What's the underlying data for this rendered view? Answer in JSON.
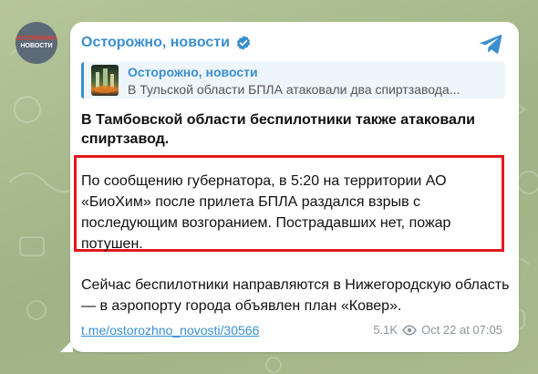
{
  "colors": {
    "accent": "#3a8fcf",
    "highlight_border": "#e0191e",
    "bubble": "#ffffff",
    "meta_text": "#8a949e"
  },
  "avatar": {
    "line1": "ОСТОРОЖНО",
    "line2": "НОВОСТИ"
  },
  "post": {
    "channel_name": "Осторожно, новости",
    "verified_icon": "verified-badge-icon",
    "share_icon": "telegram-share-icon",
    "quote": {
      "title": "Осторожно, новости",
      "text": "В Тульской области БПЛА атаковали два спиртзавода..."
    },
    "headline": "В Тамбовской области беспилотники также атаковали спиртзавод.",
    "paragraph_highlighted": "По сообщению губернатора, в 5:20 на территории АО «БиоХим» после прилета БПЛА раздался взрыв с последующим возгоранием. Пострадавших нет, пожар потушен.",
    "paragraph_2": "Сейчас беспилотники направляются в Нижегородскую область — в аэропорту города объявлен план «Ковер».",
    "link": "t.me/ostorozhno_novosti/30566",
    "views": "5.1K",
    "views_icon": "eye-icon",
    "timestamp": "Oct 22 at 07:05"
  }
}
